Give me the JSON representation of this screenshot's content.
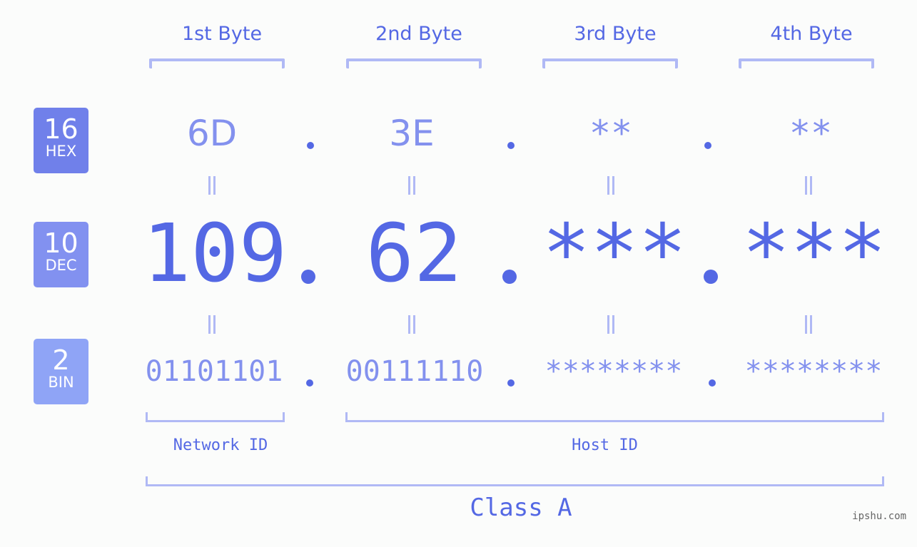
{
  "byte_headers": [
    "1st Byte",
    "2nd Byte",
    "3rd Byte",
    "4th Byte"
  ],
  "badges": {
    "hex": {
      "base": "16",
      "label": "HEX",
      "color": "#7080ea"
    },
    "dec": {
      "base": "10",
      "label": "DEC",
      "color": "#8291f0"
    },
    "bin": {
      "base": "2",
      "label": "BIN",
      "color": "#8fa4f6"
    }
  },
  "hex_values": [
    "6D",
    "3E",
    "**",
    "**"
  ],
  "dec_values": [
    "109",
    "62",
    "***",
    "***"
  ],
  "bin_values": [
    "01101101",
    "00111110",
    "********",
    "********"
  ],
  "equals_symbol": "=",
  "network_id_label": "Network ID",
  "host_id_label": "Host ID",
  "class_label": "Class A",
  "watermark": "ipshu.com",
  "colors": {
    "primary": "#5468e4",
    "secondary": "#8391ee",
    "bracket": "#b0b9f5",
    "background": "#fbfcfb"
  }
}
